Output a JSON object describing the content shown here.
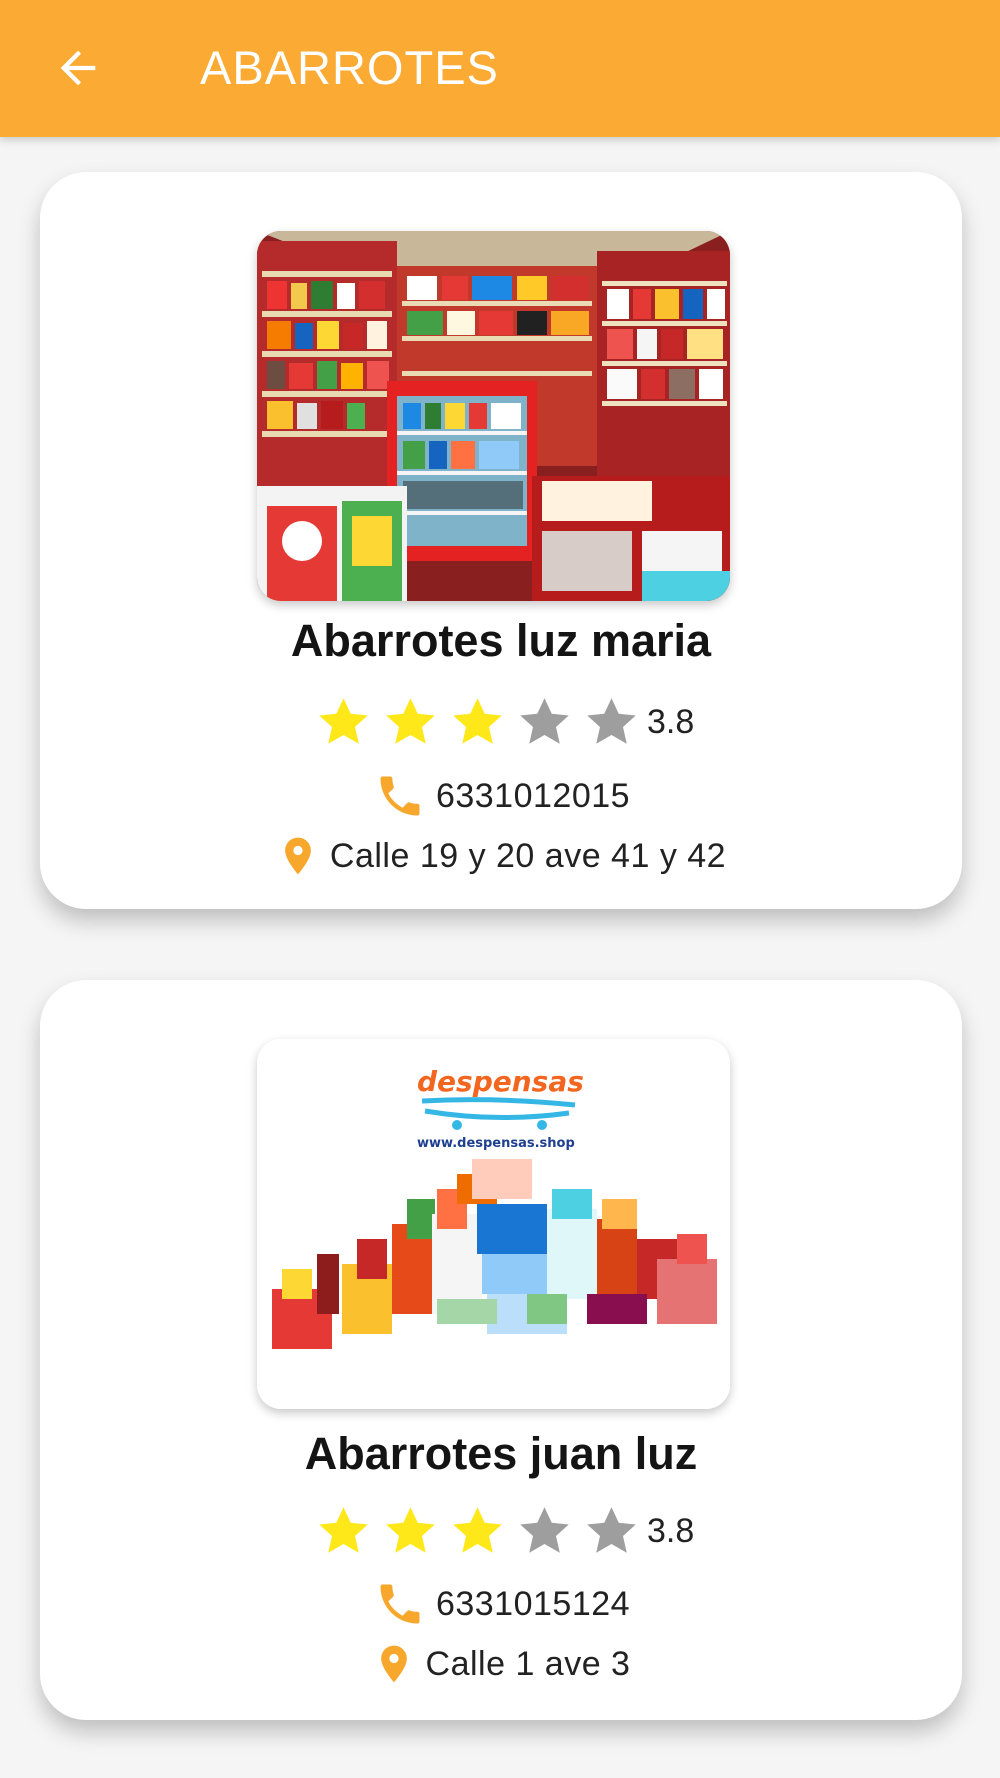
{
  "header": {
    "title": "ABARROTES",
    "back_icon": "arrow-left-icon"
  },
  "colors": {
    "accent": "#fbaa33",
    "star_filled": "#ffe81a",
    "star_empty": "#9e9e9e",
    "icon": "#f7a82c"
  },
  "stores": [
    {
      "name": "Abarrotes luz maria",
      "rating": 3.8,
      "rating_text": "3.8",
      "stars": [
        "filled",
        "filled",
        "filled",
        "empty",
        "empty"
      ],
      "phone": "6331012015",
      "address": "Calle 19 y 20 ave 41 y 42",
      "image": "store-interior-photo"
    },
    {
      "name": "Abarrotes juan luz",
      "rating": 3.8,
      "rating_text": "3.8",
      "stars": [
        "filled",
        "filled",
        "filled",
        "empty",
        "empty"
      ],
      "phone": "6331015124",
      "address": "Calle 1 ave 3",
      "image": "despensas-logo-photo",
      "image_text": {
        "logo": "despensas",
        "url": "www.despensas.shop"
      }
    }
  ]
}
